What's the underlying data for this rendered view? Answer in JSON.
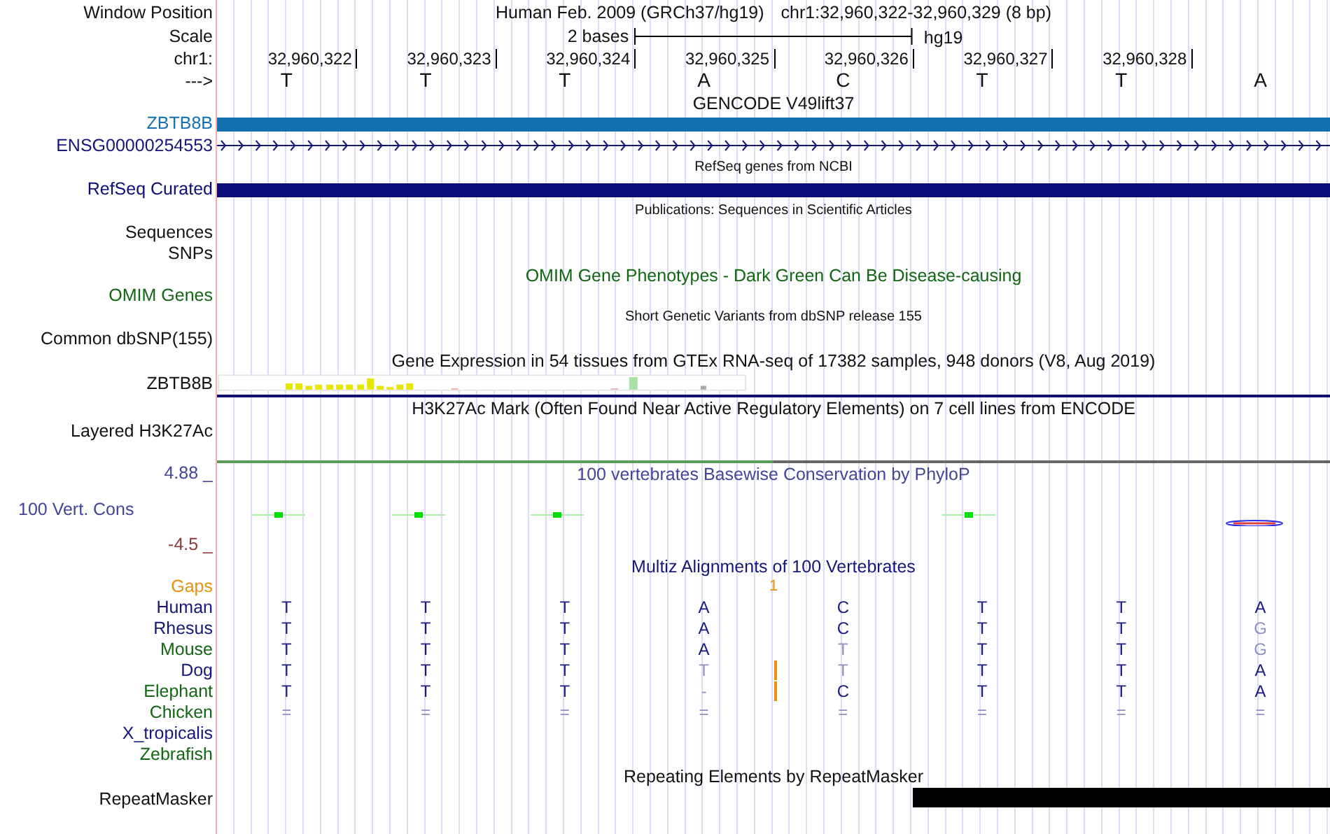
{
  "header": {
    "window_position_label": "Window Position",
    "assembly": "Human Feb. 2009 (GRCh37/hg19)",
    "position": "chr1:32,960,322-32,960,329 (8 bp)",
    "scale_label": "Scale",
    "scale_text": "2 bases",
    "scale_db": "hg19",
    "chrom_label": "chr1:",
    "ticks": [
      "32,960,322",
      "32,960,323",
      "32,960,324",
      "32,960,325",
      "32,960,326",
      "32,960,327",
      "32,960,328"
    ],
    "strand_label": "--->",
    "bases": [
      "T",
      "T",
      "T",
      "A",
      "C",
      "T",
      "T",
      "A"
    ]
  },
  "tracks": [
    {
      "kind": "title",
      "text": "GENCODE V49lift37",
      "color": "#111111"
    },
    {
      "kind": "exon",
      "label": "ZBTB8B",
      "color": "#1270b0"
    },
    {
      "kind": "intron",
      "label": "ENSG00000254553",
      "color": "#16167a"
    },
    {
      "kind": "small-title",
      "text": "RefSeq genes from NCBI",
      "color": "#111111"
    },
    {
      "kind": "exon",
      "label": "RefSeq Curated",
      "color": "#0c0c78"
    },
    {
      "kind": "small-title",
      "text": "Publications: Sequences in Scientific Articles",
      "color": "#111111"
    },
    {
      "kind": "empty",
      "label": "Sequences",
      "color": "#111111"
    },
    {
      "kind": "empty",
      "label": "SNPs",
      "color": "#111111"
    },
    {
      "kind": "title",
      "text": "OMIM Gene Phenotypes - Dark Green Can Be Disease-causing",
      "color": "#116611"
    },
    {
      "kind": "empty",
      "label": "OMIM Genes",
      "color": "#116611"
    },
    {
      "kind": "small-title",
      "text": "Short Genetic Variants from dbSNP release 155",
      "color": "#111111"
    },
    {
      "kind": "empty",
      "label": "Common dbSNP(155)",
      "color": "#111111"
    },
    {
      "kind": "title",
      "text": "Gene Expression in 54 tissues from GTEx RNA-seq of 17382 samples, 948 donors (V8, Aug 2019)",
      "color": "#111111"
    },
    {
      "kind": "gtex",
      "label": "ZBTB8B",
      "color": "#111111"
    },
    {
      "kind": "title",
      "text": "H3K27Ac Mark (Often Found Near Active Regulatory Elements) on 7 cell lines from ENCODE",
      "color": "#111111"
    },
    {
      "kind": "layered",
      "label": "Layered H3K27Ac",
      "color": "#111111"
    },
    {
      "kind": "phylop",
      "title": "100 vertebrates Basewise Conservation by PhyloP",
      "color": "#44449a",
      "max_label": "4.88 _",
      "name_label": "100 Vert. Cons",
      "min_label": "-4.5 _"
    },
    {
      "kind": "title",
      "text": "Multiz Alignments of 100 Vertebrates",
      "color": "#16167a"
    },
    {
      "kind": "gaps",
      "label": "Gaps",
      "color": "#e8900f",
      "count": "1"
    },
    {
      "kind": "species",
      "label": "Human",
      "color": "#16167a",
      "gap_line": false,
      "bases": [
        {
          "base": "T",
          "faded": false
        },
        {
          "base": "T",
          "faded": false
        },
        {
          "base": "T",
          "faded": false
        },
        {
          "base": "A",
          "faded": false
        },
        {
          "base": "C",
          "faded": false
        },
        {
          "base": "T",
          "faded": false
        },
        {
          "base": "T",
          "faded": false
        },
        {
          "base": "A",
          "faded": false
        }
      ]
    },
    {
      "kind": "species",
      "label": "Rhesus",
      "color": "#16167a",
      "gap_line": false,
      "bases": [
        {
          "base": "T",
          "faded": false
        },
        {
          "base": "T",
          "faded": false
        },
        {
          "base": "T",
          "faded": false
        },
        {
          "base": "A",
          "faded": false
        },
        {
          "base": "C",
          "faded": false
        },
        {
          "base": "T",
          "faded": false
        },
        {
          "base": "T",
          "faded": false
        },
        {
          "base": "G",
          "faded": true
        }
      ]
    },
    {
      "kind": "species",
      "label": "Mouse",
      "color": "#116611",
      "gap_line": false,
      "bases": [
        {
          "base": "T",
          "faded": false
        },
        {
          "base": "T",
          "faded": false
        },
        {
          "base": "T",
          "faded": false
        },
        {
          "base": "A",
          "faded": false
        },
        {
          "base": "T",
          "faded": true
        },
        {
          "base": "T",
          "faded": false
        },
        {
          "base": "T",
          "faded": false
        },
        {
          "base": "G",
          "faded": true
        }
      ]
    },
    {
      "kind": "species",
      "label": "Dog",
      "color": "#16167a",
      "gap_line": true,
      "bases": [
        {
          "base": "T",
          "faded": false
        },
        {
          "base": "T",
          "faded": false
        },
        {
          "base": "T",
          "faded": false
        },
        {
          "base": "T",
          "faded": true
        },
        {
          "base": "T",
          "faded": true
        },
        {
          "base": "T",
          "faded": false
        },
        {
          "base": "T",
          "faded": false
        },
        {
          "base": "A",
          "faded": false
        }
      ]
    },
    {
      "kind": "species",
      "label": "Elephant",
      "color": "#116611",
      "gap_line": true,
      "bases": [
        {
          "base": "T",
          "faded": false
        },
        {
          "base": "T",
          "faded": false
        },
        {
          "base": "T",
          "faded": false
        },
        {
          "base": "-",
          "faded": true
        },
        {
          "base": "C",
          "faded": false
        },
        {
          "base": "T",
          "faded": false
        },
        {
          "base": "T",
          "faded": false
        },
        {
          "base": "A",
          "faded": false
        }
      ]
    },
    {
      "kind": "species",
      "label": "Chicken",
      "color": "#116611",
      "gap_line": false,
      "bases": [
        {
          "base": "=",
          "faded": true
        },
        {
          "base": "=",
          "faded": true
        },
        {
          "base": "=",
          "faded": true
        },
        {
          "base": "=",
          "faded": true
        },
        {
          "base": "=",
          "faded": true
        },
        {
          "base": "=",
          "faded": true
        },
        {
          "base": "=",
          "faded": true
        },
        {
          "base": "=",
          "faded": true
        }
      ]
    },
    {
      "kind": "species",
      "label": "X_tropicalis",
      "color": "#16167a",
      "gap_line": false
    },
    {
      "kind": "species",
      "label": "Zebrafish",
      "color": "#116611",
      "gap_line": false
    },
    {
      "kind": "title",
      "text": "Repeating Elements by RepeatMasker",
      "color": "#111111"
    },
    {
      "kind": "repeat",
      "label": "RepeatMasker",
      "color": "#111111"
    }
  ]
}
